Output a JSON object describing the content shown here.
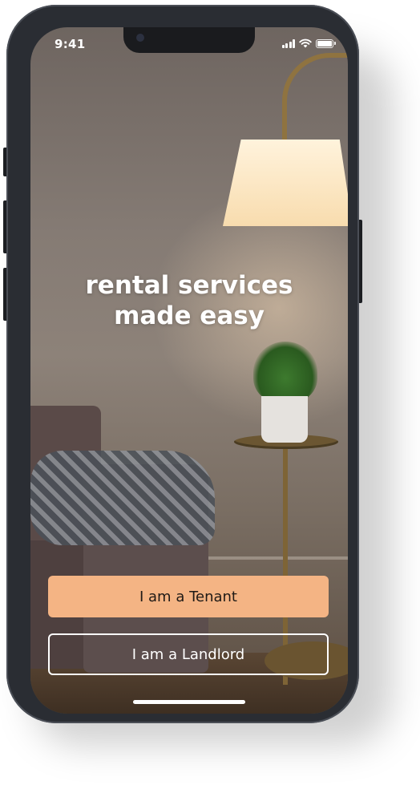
{
  "status_bar": {
    "time": "9:41",
    "icons": [
      "signal-icon",
      "wifi-icon",
      "battery-icon"
    ]
  },
  "hero": {
    "headline_line1": "rental services",
    "headline_line2": "made easy"
  },
  "actions": {
    "tenant_label": "I am a Tenant",
    "landlord_label": "I am a Landlord"
  },
  "colors": {
    "accent": "#f4b484",
    "text_light": "#ffffff"
  }
}
